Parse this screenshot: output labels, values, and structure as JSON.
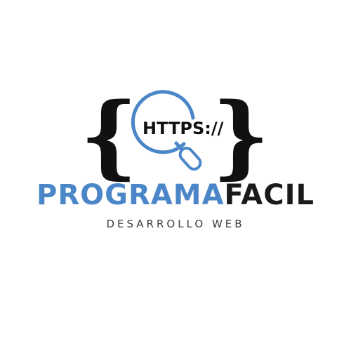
{
  "logo": {
    "url_text": "HTTPS://",
    "brace_left": "{",
    "brace_right": "}",
    "wordmark_part1": "PROGRAMA",
    "wordmark_part2": "FACIL",
    "tagline": "DESARROLLO WEB"
  },
  "colors": {
    "blue": "#4a86c8",
    "dark": "#1a1a1a",
    "tagline": "#3a3a3a"
  }
}
